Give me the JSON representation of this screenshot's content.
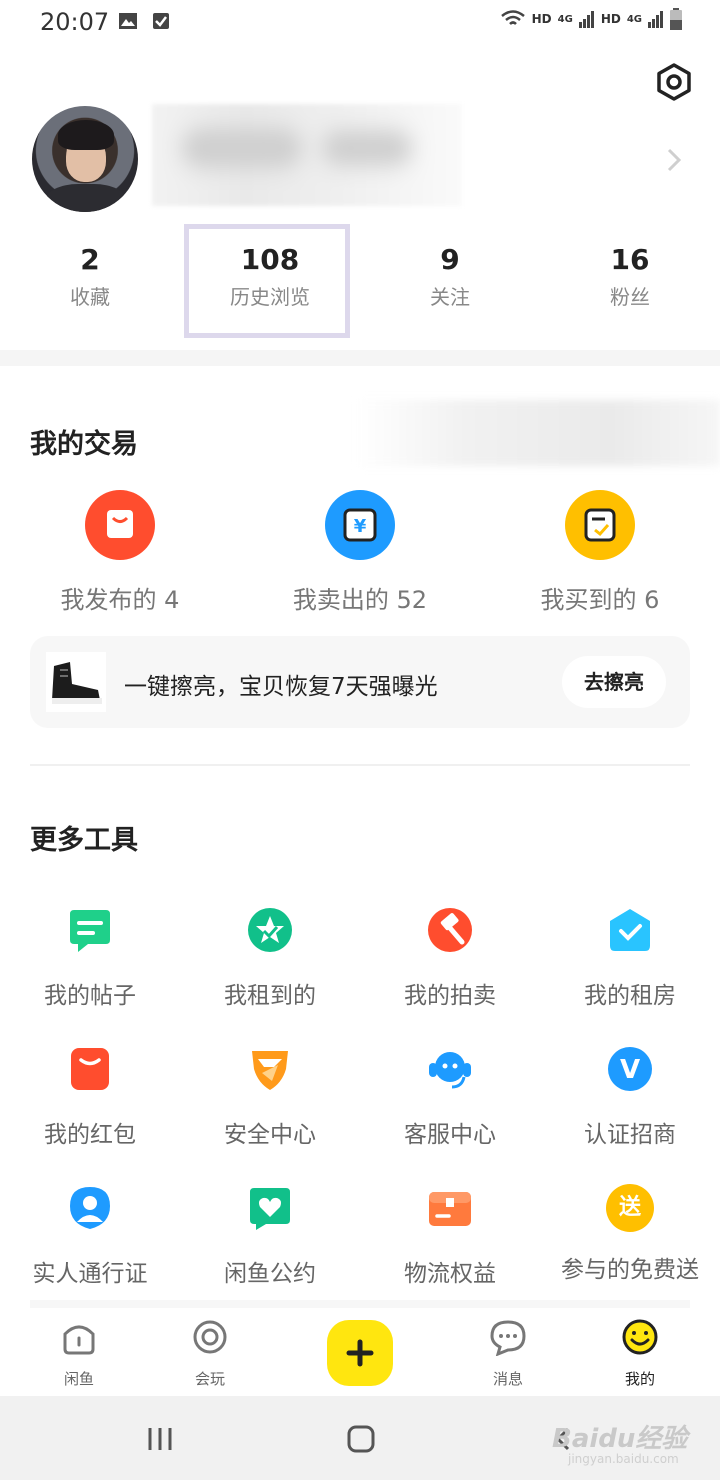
{
  "status_bar": {
    "time": "20:07",
    "network": [
      "HD",
      "4G",
      "HD",
      "4G"
    ]
  },
  "profile": {
    "settings_icon": "hexagon-settings-icon",
    "stats": [
      {
        "value": "2",
        "label": "收藏"
      },
      {
        "value": "108",
        "label": "历史浏览"
      },
      {
        "value": "9",
        "label": "关注"
      },
      {
        "value": "16",
        "label": "粉丝"
      }
    ]
  },
  "trade": {
    "title": "我的交易",
    "items": [
      {
        "label": "我发布的 4",
        "icon": "bag-icon",
        "color": "#ff4d2e"
      },
      {
        "label": "我卖出的 52",
        "icon": "yuan-icon",
        "color": "#1e9bff"
      },
      {
        "label": "我买到的 6",
        "icon": "receipt-icon",
        "color": "#ffbf00"
      }
    ],
    "promo": {
      "text": "一键擦亮，宝贝恢复7天强曝光",
      "button": "去擦亮"
    }
  },
  "tools": {
    "title": "更多工具",
    "items": [
      {
        "label": "我的帖子",
        "icon": "post-icon",
        "color": "#1fd08a"
      },
      {
        "label": "我租到的",
        "icon": "rent-star-icon",
        "color": "#11c08a"
      },
      {
        "label": "我的拍卖",
        "icon": "auction-hammer-icon",
        "color": "#ff4d2e"
      },
      {
        "label": "我的租房",
        "icon": "house-check-icon",
        "color": "#29c4ff"
      },
      {
        "label": "我的红包",
        "icon": "red-packet-icon",
        "color": "#ff4d2e"
      },
      {
        "label": "安全中心",
        "icon": "shield-icon",
        "color": "#ff9a1a"
      },
      {
        "label": "客服中心",
        "icon": "headset-icon",
        "color": "#1e9bff"
      },
      {
        "label": "认证招商",
        "icon": "verified-v-icon",
        "color": "#1e9bff"
      },
      {
        "label": "实人通行证",
        "icon": "person-badge-icon",
        "color": "#1e9bff"
      },
      {
        "label": "闲鱼公约",
        "icon": "heart-doc-icon",
        "color": "#11c08a"
      },
      {
        "label": "物流权益",
        "icon": "box-icon",
        "color": "#ff7a3d"
      },
      {
        "label": "参与的免费送",
        "icon": "free-gift-icon",
        "color": "#ffbf00",
        "badge": "送"
      }
    ]
  },
  "bottom_nav": {
    "items": [
      {
        "label": "闲鱼",
        "icon": "home-fish-icon"
      },
      {
        "label": "会玩",
        "icon": "circle-play-icon"
      },
      {
        "label": "",
        "icon": "plus-icon"
      },
      {
        "label": "消息",
        "icon": "message-icon"
      },
      {
        "label": "我的",
        "icon": "smiley-icon",
        "active": true
      }
    ],
    "active_color": "#ffe60f"
  },
  "watermark": {
    "text": "Baidu经验",
    "sub": "jingyan.baidu.com"
  }
}
